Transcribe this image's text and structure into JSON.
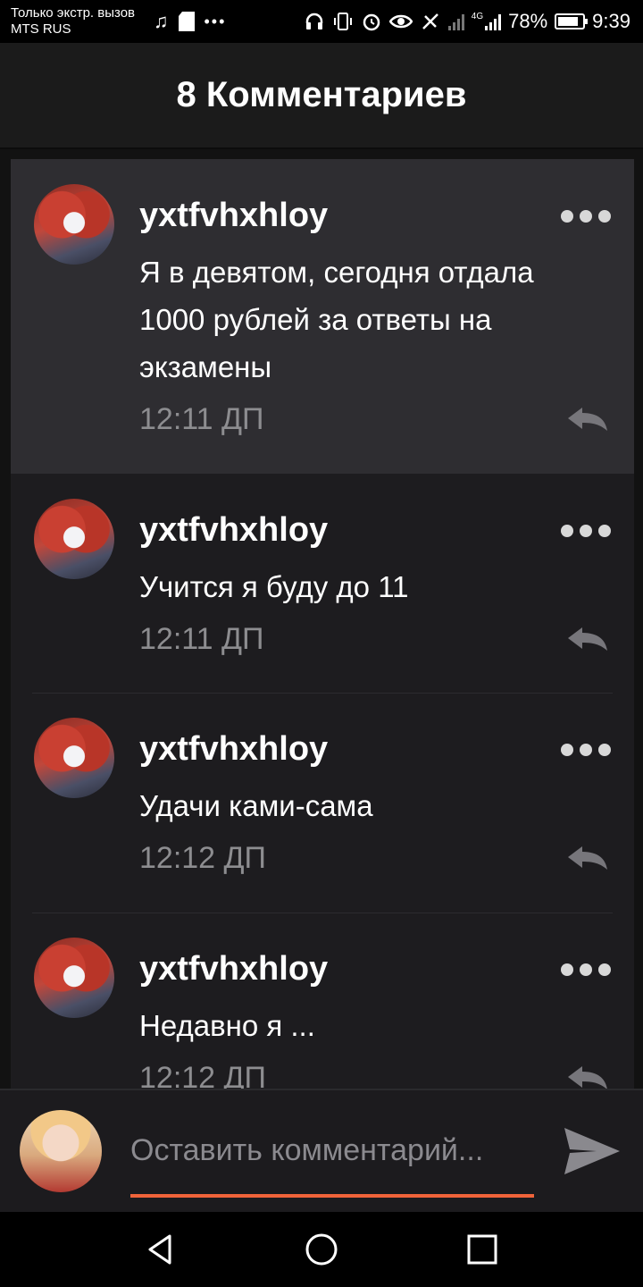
{
  "status_bar": {
    "carrier_line1": "Только экстр. вызов",
    "carrier_line2": "MTS RUS",
    "icons_left": [
      "music-note-icon",
      "sd-card-icon",
      "more-dots-icon"
    ],
    "icons_right": [
      "headset-icon",
      "vibrate-icon",
      "alarm-icon",
      "eye-icon",
      "no-sim-icon",
      "signal-icon",
      "signal-4g-icon"
    ],
    "network_label": "4G",
    "battery": "78%",
    "time": "9:39"
  },
  "header": {
    "title": "8 Комментариев"
  },
  "comments": [
    {
      "username": "yxtfvhxhloy",
      "lines": [
        "Я в девятом, сегодня отдала",
        "1000 рублей за ответы на",
        "экзамены"
      ],
      "time": "12:11 ДП"
    },
    {
      "username": "yxtfvhxhloy",
      "lines": [
        "Учится я буду до 11"
      ],
      "time": "12:11 ДП"
    },
    {
      "username": "yxtfvhxhloy",
      "lines": [
        "Удачи ками-сама"
      ],
      "time": "12:12 ДП"
    },
    {
      "username": "yxtfvhxhloy",
      "lines": [
        "Недавно я ..."
      ],
      "time": "12:12 ДП"
    }
  ],
  "composer": {
    "placeholder": "Оставить комментарий..."
  },
  "colors": {
    "accent": "#f0643a",
    "background": "#1d1c1f",
    "highlight": "#2e2d31",
    "muted_text": "#8d8d90"
  }
}
